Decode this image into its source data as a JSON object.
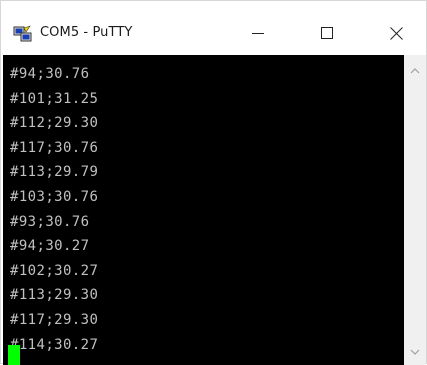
{
  "window": {
    "title": "COM5 - PuTTY",
    "app_icon": "putty-icon",
    "controls": {
      "minimize_icon": "minimize-icon",
      "maximize_icon": "maximize-icon",
      "close_icon": "close-icon"
    }
  },
  "terminal": {
    "background": "#000000",
    "text_color": "#c0c0c0",
    "cursor_color": "#00ff00",
    "lines": [
      "#94;30.76",
      "#101;31.25",
      "#112;29.30",
      "#117;30.76",
      "#113;29.79",
      "#103;30.76",
      "#93;30.76",
      "#94;30.27",
      "#102;30.27",
      "#113;29.30",
      "#117;29.30",
      "#114;30.27"
    ]
  },
  "scrollbar": {
    "up_icon": "chevron-up-icon",
    "down_icon": "chevron-down-icon"
  }
}
